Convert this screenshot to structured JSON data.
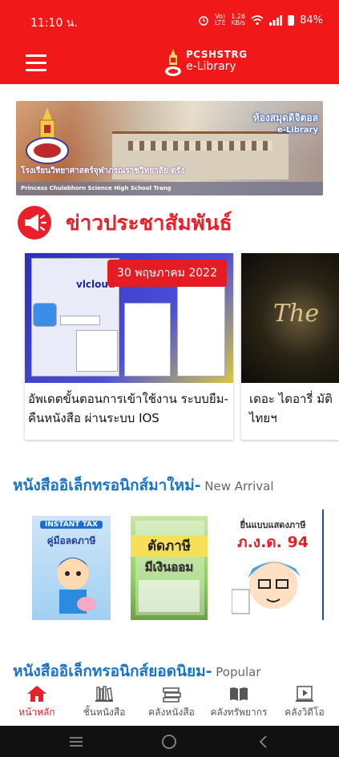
{
  "status_bar": {
    "time": "11:10 น.",
    "signal_type": "LTE",
    "net_label": "Vo)",
    "data_speed": "1.26",
    "data_unit": "KB/s",
    "battery": "84%"
  },
  "app_bar": {
    "logo_line1": "PCSHSTRG",
    "logo_line2": "e-Library"
  },
  "banner": {
    "library_text_th": "ห้องสมุดดิจิตอล",
    "library_text_en": "e-Library",
    "school_th": "โรงเรียนวิทยาศาสตร์จุฬาภรณราชวิทยาลัย ตรัง",
    "school_en": "Princess Chulabhorn Science High School Trang"
  },
  "news": {
    "title": "ข่าวประชาสัมพันธ์",
    "cards": [
      {
        "date": "30 พฤษภาคม 2022",
        "text": "อัพเดตขั้นตอนการเข้าใช้งาน ระบบยืม-คืนหนังสือ ผ่านระบบ IOS",
        "image_text": "vlcloud"
      },
      {
        "text": "เดอะ ไดอารี่ มัติไทยฯ",
        "image_text": "The"
      }
    ]
  },
  "new_arrival": {
    "title_th": "หนังสืออิเล็กทรอนิกส์มาใหม่-",
    "title_en": " New Arrival",
    "books": [
      {
        "cover_line1": "INSTANT TAX",
        "cover_line2": "คู่มือลดภาษี"
      },
      {
        "cover_line1": "ตัดภาษี",
        "cover_line2": "มีเงินออม"
      },
      {
        "cover_line1": "ยื่นแบบแสดงภาษี",
        "cover_line2": "ภ.ง.ด. 94"
      }
    ]
  },
  "popular": {
    "title_th": "หนังสืออิเล็กทรอนิกส์ยอดนิยม-",
    "title_en": " Popular"
  },
  "bottom_nav": {
    "items": [
      {
        "label": "หน้าหลัก",
        "icon": "home-icon"
      },
      {
        "label": "ชั้นหนังสือ",
        "icon": "bookshelf-icon"
      },
      {
        "label": "คลังหนังสือ",
        "icon": "books-stack-icon"
      },
      {
        "label": "คลังทรัพยากร",
        "icon": "open-book-icon"
      },
      {
        "label": "คลังวิดีโอ",
        "icon": "video-icon"
      }
    ]
  },
  "colors": {
    "primary": "#f01818",
    "section_blue": "#1873cc",
    "active": "#e8202a"
  }
}
